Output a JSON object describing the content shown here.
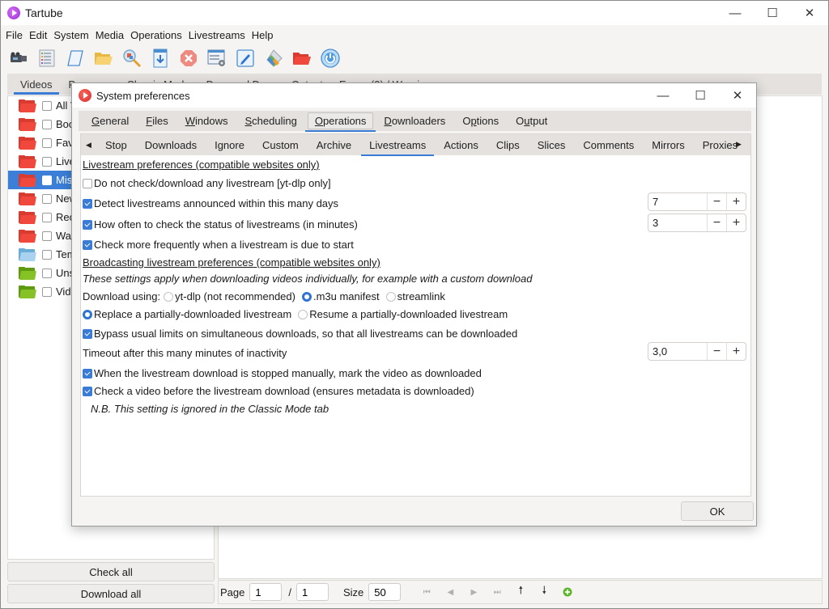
{
  "app": {
    "title": "Tartube",
    "window_controls": {
      "minimize": "—",
      "maximize": "☐",
      "close": "✕"
    }
  },
  "menubar": [
    "File",
    "Edit",
    "System",
    "Media",
    "Operations",
    "Livestreams",
    "Help"
  ],
  "toolbar": [
    {
      "icon": "video-camera-icon"
    },
    {
      "icon": "list-icon"
    },
    {
      "icon": "scroll-icon"
    },
    {
      "icon": "folder-open-icon"
    },
    {
      "icon": "magnifier-icon"
    },
    {
      "icon": "download-icon"
    },
    {
      "icon": "stop-icon"
    },
    {
      "icon": "settings-list-icon"
    },
    {
      "icon": "edit-pencil-icon"
    },
    {
      "icon": "tags-icon"
    },
    {
      "icon": "red-folder-icon"
    },
    {
      "icon": "power-icon"
    }
  ],
  "main_tabs": [
    {
      "label": "Videos",
      "active": true
    },
    {
      "label": "Progress"
    },
    {
      "label": "Classic Mode"
    },
    {
      "label": "Drag and Drop"
    },
    {
      "label": "Output"
    },
    {
      "label": "Errors (3) / Warnings"
    }
  ],
  "sidebar": {
    "folders": [
      {
        "label": "All Videos",
        "color": "red"
      },
      {
        "label": "Bookmarks",
        "color": "red"
      },
      {
        "label": "Favourite Videos",
        "color": "red"
      },
      {
        "label": "Livestreams",
        "color": "red"
      },
      {
        "label": "Missing Videos",
        "color": "red",
        "selected": true
      },
      {
        "label": "New Videos",
        "color": "red"
      },
      {
        "label": "Recent Videos",
        "color": "red"
      },
      {
        "label": "Waiting Videos",
        "color": "red"
      },
      {
        "label": "Temporary Videos",
        "color": "blue"
      },
      {
        "label": "Unsorted Videos",
        "color": "green"
      },
      {
        "label": "Video Clips",
        "color": "green"
      }
    ],
    "check_all": "Check all",
    "download_all": "Download all"
  },
  "pager": {
    "page_label": "Page",
    "page_value": "1",
    "separator": "/",
    "total_pages": "1",
    "size_label": "Size",
    "size_value": "50"
  },
  "dialog": {
    "title": "System preferences",
    "top_tabs": [
      {
        "label": "General",
        "u": "G"
      },
      {
        "label": "Files",
        "u": "F"
      },
      {
        "label": "Windows",
        "u": "W"
      },
      {
        "label": "Scheduling",
        "u": "S"
      },
      {
        "label": "Operations",
        "u": "O",
        "active": true
      },
      {
        "label": "Downloaders",
        "u": "D"
      },
      {
        "label": "Options",
        "u": "p"
      },
      {
        "label": "Output",
        "u": "u"
      }
    ],
    "sub_tabs": [
      {
        "label": "Stop"
      },
      {
        "label": "Downloads"
      },
      {
        "label": "Ignore"
      },
      {
        "label": "Custom"
      },
      {
        "label": "Archive"
      },
      {
        "label": "Livestreams",
        "active": true
      },
      {
        "label": "Actions"
      },
      {
        "label": "Clips"
      },
      {
        "label": "Slices"
      },
      {
        "label": "Comments"
      },
      {
        "label": "Mirrors"
      },
      {
        "label": "Proxies"
      }
    ],
    "section1_heading": "Livestream preferences (compatible websites only)",
    "opt_no_check": {
      "label": "Do not check/download any livestream [yt-dlp only]",
      "checked": false
    },
    "opt_detect_days": {
      "label": "Detect livestreams announced within this many days",
      "checked": true,
      "value": "7"
    },
    "opt_check_minutes": {
      "label": "How often to check the status of livestreams (in minutes)",
      "checked": true,
      "value": "3"
    },
    "opt_check_frequent": {
      "label": "Check more frequently when a livestream is due to start",
      "checked": true
    },
    "section2_heading": "Broadcasting livestream preferences (compatible websites only)",
    "section2_note": "These settings apply when downloading videos individually, for example with a custom download",
    "download_using_label": "Download using:",
    "download_using_options": [
      {
        "label": "yt-dlp (not recommended)",
        "selected": false
      },
      {
        "label": ".m3u manifest",
        "selected": true
      },
      {
        "label": "streamlink",
        "selected": false
      }
    ],
    "partial_options": [
      {
        "label": "Replace a partially-downloaded livestream",
        "selected": true
      },
      {
        "label": "Resume a partially-downloaded livestream",
        "selected": false
      }
    ],
    "opt_bypass": {
      "label": "Bypass usual limits on simultaneous downloads, so that all livestreams can be downloaded",
      "checked": true
    },
    "timeout_label": "Timeout after this many minutes of inactivity",
    "timeout_value": "3,0",
    "opt_mark_downloaded": {
      "label": "When the livestream download is stopped manually, mark the video as downloaded",
      "checked": true
    },
    "opt_check_before": {
      "label": "Check a video before the livestream download (ensures metadata is downloaded)",
      "checked": true
    },
    "nb_note": "N.B. This setting is ignored in the Classic Mode tab",
    "ok_label": "OK",
    "spin_minus": "−",
    "spin_plus": "+"
  },
  "colors": {
    "accent": "#3a7bd5",
    "selection": "#3b7fd9",
    "folder_red": "#f0483c",
    "folder_blue": "#8cc3ea",
    "folder_green": "#7db81e"
  }
}
